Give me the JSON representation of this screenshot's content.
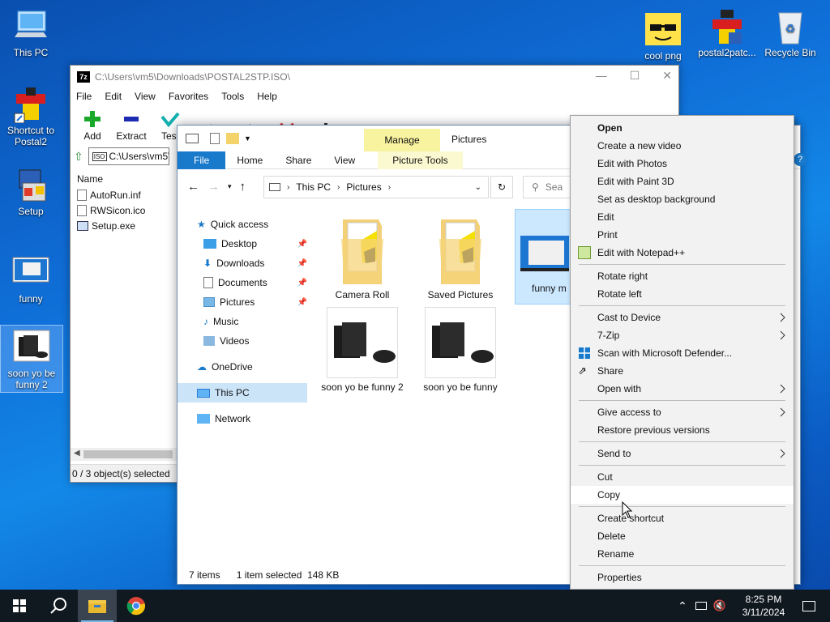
{
  "desktop": {
    "icons": [
      {
        "label": "This PC"
      },
      {
        "label": "Shortcut to Postal2"
      },
      {
        "label": "Setup"
      },
      {
        "label": "funny"
      },
      {
        "label": "soon yo be funny 2"
      },
      {
        "label": "cool png"
      },
      {
        "label": "postal2patc..."
      },
      {
        "label": "Recycle Bin"
      }
    ]
  },
  "zip": {
    "title": "C:\\Users\\vm5\\Downloads\\POSTAL2STP.ISO\\",
    "menu": [
      "File",
      "Edit",
      "View",
      "Favorites",
      "Tools",
      "Help"
    ],
    "toolbar": [
      "Add",
      "Extract",
      "Test"
    ],
    "address": "C:\\Users\\vm5\\",
    "column": "Name",
    "files": [
      "AutoRun.inf",
      "RWSicon.ico",
      "Setup.exe"
    ],
    "status": "0 / 3 object(s) selected"
  },
  "explorer": {
    "manage": "Manage",
    "location": "Pictures",
    "picture_tools": "Picture Tools",
    "tabs": [
      "File",
      "Home",
      "Share",
      "View"
    ],
    "breadcrumb": [
      "This PC",
      "Pictures"
    ],
    "search_placeholder": "Sea",
    "nav": [
      {
        "label": "Quick access"
      },
      {
        "label": "Desktop"
      },
      {
        "label": "Downloads"
      },
      {
        "label": "Documents"
      },
      {
        "label": "Pictures"
      },
      {
        "label": "Music"
      },
      {
        "label": "Videos"
      },
      {
        "label": "OneDrive"
      },
      {
        "label": "This PC"
      },
      {
        "label": "Network"
      }
    ],
    "items": [
      "Camera Roll",
      "Saved Pictures",
      "funny m",
      "soon yo be funny 2",
      "soon yo be funny"
    ],
    "status_count": "7 items",
    "status_sel": "1 item selected  148 KB"
  },
  "context_menu": {
    "items": [
      "Open",
      "Create a new video",
      "Edit with Photos",
      "Edit with Paint 3D",
      "Set as desktop background",
      "Edit",
      "Print",
      "Edit with Notepad++",
      "Rotate right",
      "Rotate left",
      "Cast to Device",
      "7-Zip",
      "Scan with Microsoft Defender...",
      "Share",
      "Open with",
      "Give access to",
      "Restore previous versions",
      "Send to",
      "Cut",
      "Copy",
      "Create shortcut",
      "Delete",
      "Rename",
      "Properties"
    ]
  },
  "taskbar": {
    "time": "8:25 PM",
    "date": "3/11/2024"
  },
  "colors": {
    "accent": "#1979ca",
    "manage_bg": "#f7f39e",
    "selection": "#cce8ff"
  }
}
